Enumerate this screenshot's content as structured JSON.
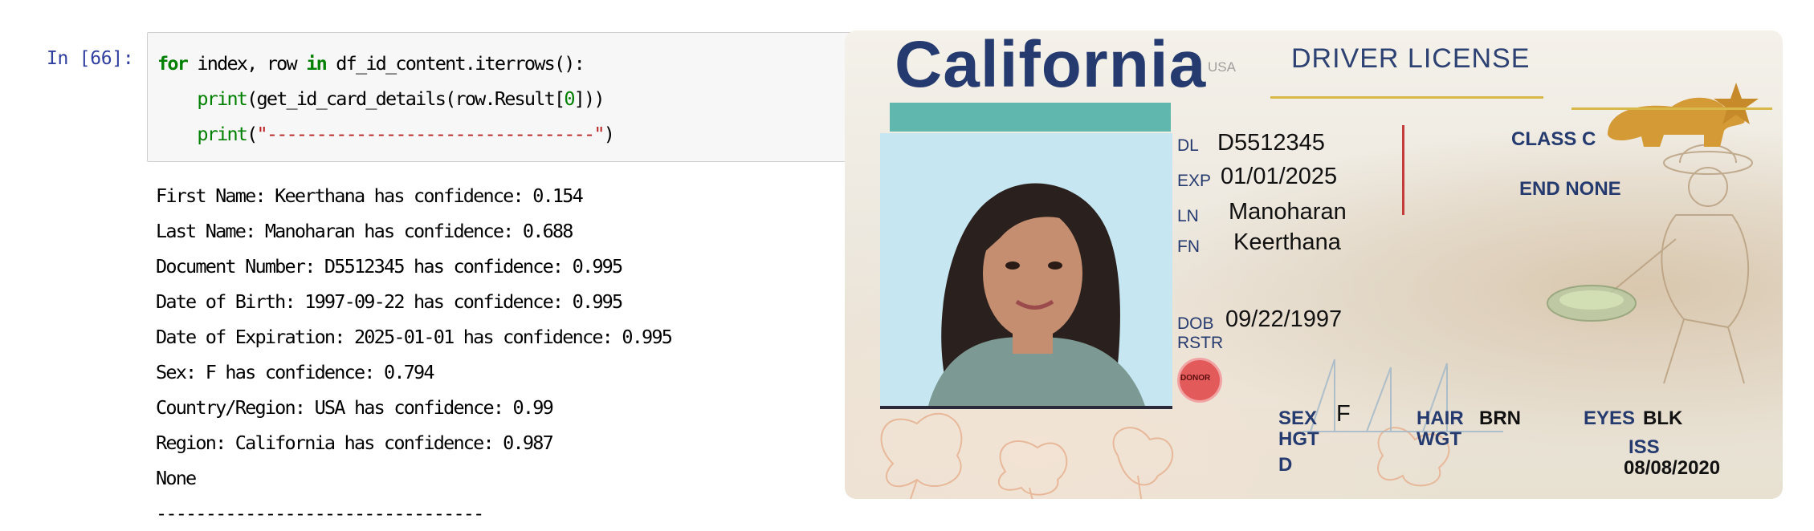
{
  "cell": {
    "prompt": "In [66]:",
    "code": {
      "l1_kw_for": "for",
      "l1_mid": " index, row ",
      "l1_kw_in": "in",
      "l1_tail": " df_id_content.iterrows():",
      "l2_indent": "    ",
      "l2_print": "print",
      "l2_a": "(get_id_card_details(row.Result[",
      "l2_num": "0",
      "l2_b": "]))",
      "l3_indent": "    ",
      "l3_print": "print",
      "l3_a": "(",
      "l3_str": "\"---------------------------------\"",
      "l3_b": ")"
    },
    "output_lines": [
      "First Name: Keerthana has confidence: 0.154",
      "Last Name: Manoharan has confidence: 0.688",
      "Document Number: D5512345 has confidence: 0.995",
      "Date of Birth: 1997-09-22 has confidence: 0.995",
      "Date of Expiration: 2025-01-01 has confidence: 0.995",
      "Sex: F has confidence: 0.794",
      "Country/Region: USA has confidence: 0.99",
      "Region: California has confidence: 0.987",
      "None",
      "---------------------------------"
    ]
  },
  "card": {
    "state": "California",
    "country": "USA",
    "doc_title": "DRIVER LICENSE",
    "dl_label": "DL",
    "dl_value": "D5512345",
    "exp_label": "EXP",
    "exp_value": "01/01/2025",
    "ln_label": "LN",
    "ln_value": "Manoharan",
    "fn_label": "FN",
    "fn_value": "Keerthana",
    "class_label": "CLASS C",
    "end_label": "END NONE",
    "dob_label": "DOB",
    "dob_value": "09/22/1997",
    "rstr_label": "RSTR",
    "donor_label": "DONOR",
    "sex_label": "SEX",
    "sex_value": "F",
    "hgt_label": "HGT",
    "d_label": "D",
    "hair_label": "HAIR",
    "hair_value": "BRN",
    "wgt_label": "WGT",
    "eyes_label": "EYES",
    "eyes_value": "BLK",
    "iss_label": "ISS",
    "iss_value": "08/08/2020"
  },
  "colors": {
    "prompt": "#303f9f",
    "keyword": "#008000",
    "string": "#ba2121",
    "card_navy": "#253a6e",
    "card_gold": "#d9b84a"
  },
  "icons": [
    "state-bear-emblem",
    "gold-miner-illustration",
    "poppy-flowers",
    "sailboat-hologram",
    "donor-heart-badge"
  ]
}
